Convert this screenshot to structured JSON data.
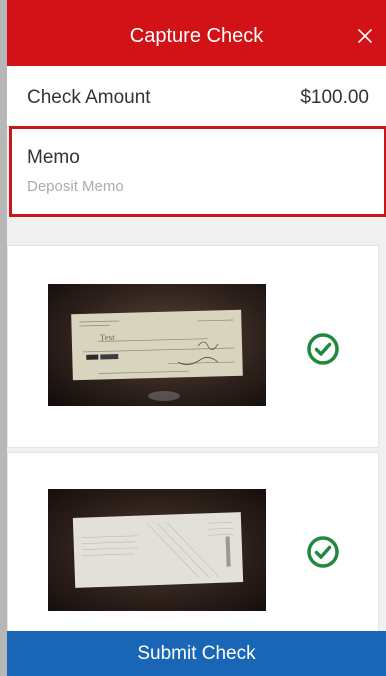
{
  "header": {
    "title": "Capture Check",
    "close_icon": "close-icon",
    "background": "#d21216"
  },
  "amount": {
    "label": "Check Amount",
    "value": "$100.00"
  },
  "memo": {
    "label": "Memo",
    "value": "",
    "placeholder": "Deposit Memo",
    "highlight_color": "#c8161c"
  },
  "images": {
    "front": {
      "alt": "Check front",
      "status_icon": "check-circle-icon",
      "status_color": "#1f8a3c"
    },
    "back": {
      "alt": "Check back",
      "status_icon": "check-circle-icon",
      "status_color": "#1f8a3c"
    }
  },
  "footer": {
    "submit_label": "Submit Check",
    "background": "#1a66b6"
  }
}
